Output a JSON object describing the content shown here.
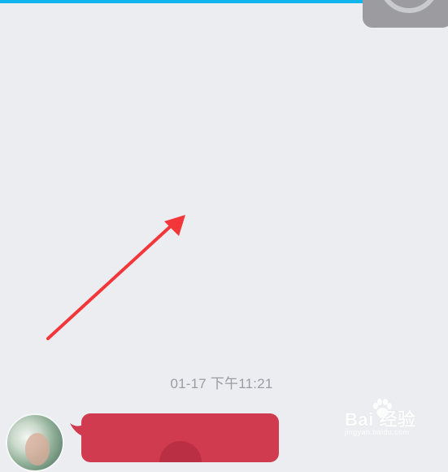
{
  "chat": {
    "timestamp": "01-17 下午11:21"
  },
  "watermark": {
    "brand": "Bai 经验",
    "url": "jingyan.baidu.com"
  },
  "colors": {
    "top_bar": "#0fb5ec",
    "background": "#ecedf1",
    "red_packet": "#d03b50",
    "arrow": "#f2363a"
  },
  "icons": {
    "floating_button": "camera-ring-icon",
    "annotation": "arrow-icon"
  }
}
